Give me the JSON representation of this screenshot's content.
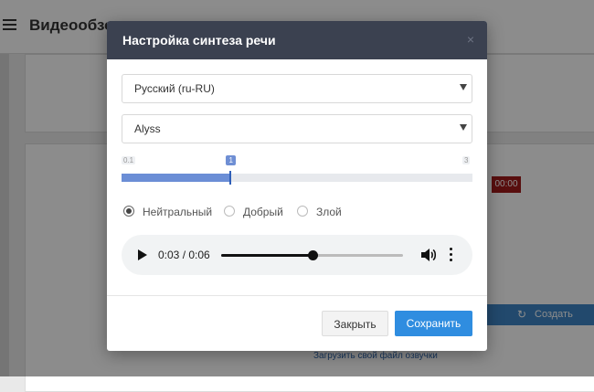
{
  "background": {
    "app_title": "Видеообзо",
    "timer_badge": "00:00",
    "create_button": "Создать",
    "upload_link": "Загрузить свой файл озвучки",
    "timer_color": "#a11a1a",
    "accent_color": "#3e86c6"
  },
  "modal": {
    "title": "Настройка синтеза речи",
    "close_glyph": "×",
    "language_select": {
      "value": "Русский (ru-RU)"
    },
    "voice_select": {
      "value": "Alyss"
    },
    "speed_slider": {
      "min_label": "0.1",
      "max_label": "3",
      "current_label": "1",
      "min": 0.1,
      "max": 3,
      "value": 1
    },
    "emotion_options": [
      {
        "label": "Нейтральный",
        "selected": true
      },
      {
        "label": "Добрый",
        "selected": false
      },
      {
        "label": "Злой",
        "selected": false
      }
    ],
    "player": {
      "time": "0:03 / 0:06",
      "progress": 0.5,
      "icons": [
        "play-icon",
        "volume-icon",
        "more-vert-icon"
      ]
    },
    "buttons": {
      "close_label": "Закрыть",
      "save_label": "Сохранить"
    },
    "colors": {
      "header": "#3b4150",
      "primary": "#2f8de0",
      "slider": "#6b8ed6"
    }
  }
}
